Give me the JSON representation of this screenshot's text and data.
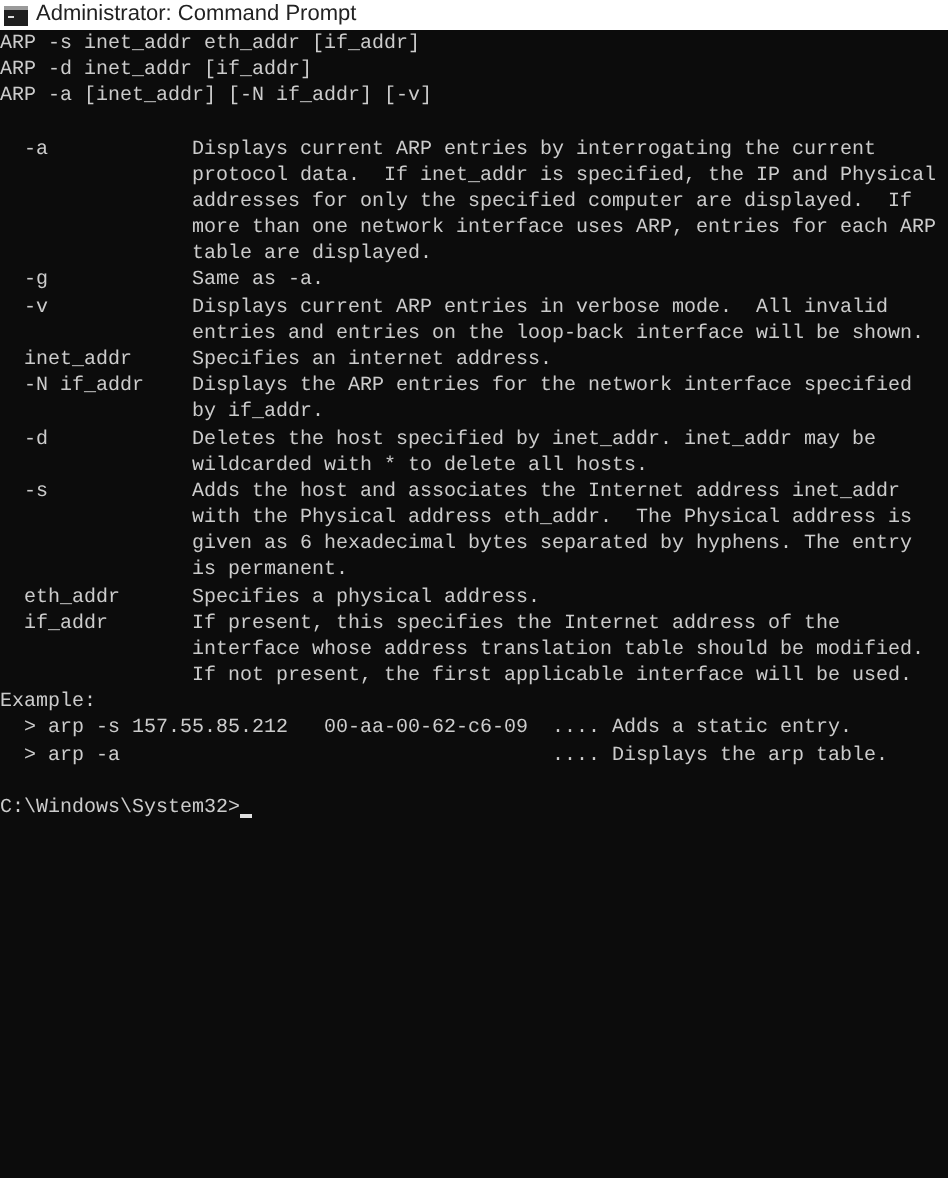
{
  "window": {
    "title": "Administrator: Command Prompt"
  },
  "usage": [
    "ARP -s inet_addr eth_addr [if_addr]",
    "ARP -d inet_addr [if_addr]",
    "ARP -a [inet_addr] [-N if_addr] [-v]"
  ],
  "options": [
    {
      "flag": "-a",
      "description": "Displays current ARP entries by interrogating the current\nprotocol data.  If inet_addr is specified, the IP and Physical\naddresses for only the specified computer are displayed.  If\nmore than one network interface uses ARP, entries for each ARP\ntable are displayed."
    },
    {
      "flag": "-g",
      "description": "Same as -a."
    },
    {
      "flag": "-v",
      "description": "Displays current ARP entries in verbose mode.  All invalid\nentries and entries on the loop-back interface will be shown."
    },
    {
      "flag": "inet_addr",
      "description": "Specifies an internet address."
    },
    {
      "flag": "-N if_addr",
      "description": "Displays the ARP entries for the network interface specified\nby if_addr."
    },
    {
      "flag": "-d",
      "description": "Deletes the host specified by inet_addr. inet_addr may be\nwildcarded with * to delete all hosts."
    },
    {
      "flag": "-s",
      "description": "Adds the host and associates the Internet address inet_addr\nwith the Physical address eth_addr.  The Physical address is\ngiven as 6 hexadecimal bytes separated by hyphens. The entry\nis permanent."
    },
    {
      "flag": "eth_addr",
      "description": "Specifies a physical address."
    },
    {
      "flag": "if_addr",
      "description": "If present, this specifies the Internet address of the\ninterface whose address translation table should be modified.\nIf not present, the first applicable interface will be used."
    }
  ],
  "example": {
    "heading": "Example:",
    "commands": [
      {
        "marker": ">",
        "command": "arp -s 157.55.85.212   00-aa-00-62-c6-09",
        "comment": ".... Adds a static entry."
      },
      {
        "marker": ">",
        "command": "arp -a",
        "comment": ".... Displays the arp table."
      }
    ]
  },
  "prompt": {
    "text": "C:\\Windows\\System32>",
    "cursor": true
  }
}
